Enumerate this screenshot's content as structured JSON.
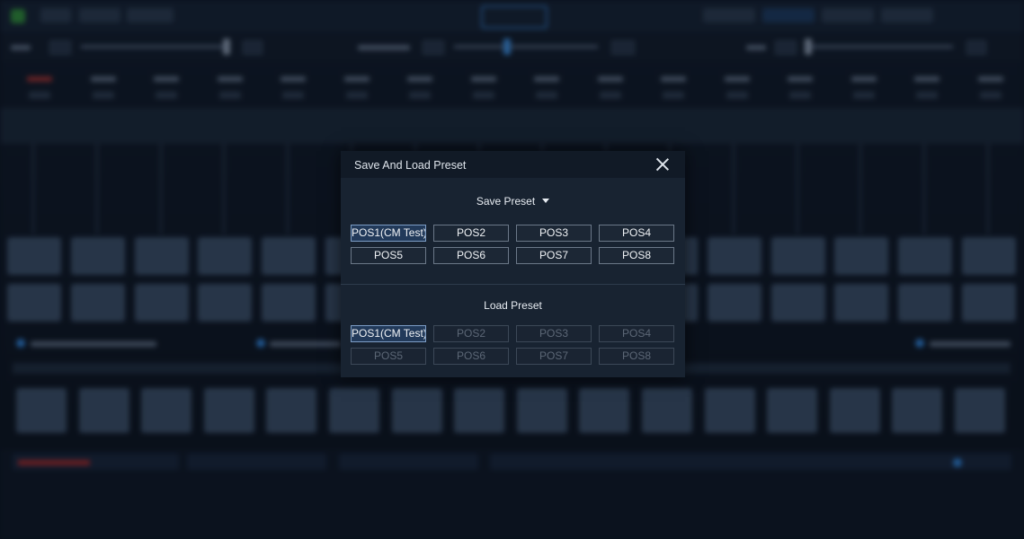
{
  "dialog": {
    "title": "Save And Load Preset",
    "save": {
      "title": "Save Preset",
      "presets": [
        "POS1(CM Test)",
        "POS2",
        "POS3",
        "POS4",
        "POS5",
        "POS6",
        "POS7",
        "POS8"
      ]
    },
    "load": {
      "title": "Load Preset",
      "presets": [
        "POS1(CM Test)",
        "POS2",
        "POS3",
        "POS4",
        "POS5",
        "POS6",
        "POS7",
        "POS8"
      ],
      "enabled": [
        true,
        false,
        false,
        false,
        false,
        false,
        false,
        false
      ]
    }
  },
  "colors": {
    "dialog_bg": "#182331",
    "titlebar_bg": "#111a26",
    "active_border": "#7d9ec6",
    "disabled_text": "#5c6776"
  }
}
